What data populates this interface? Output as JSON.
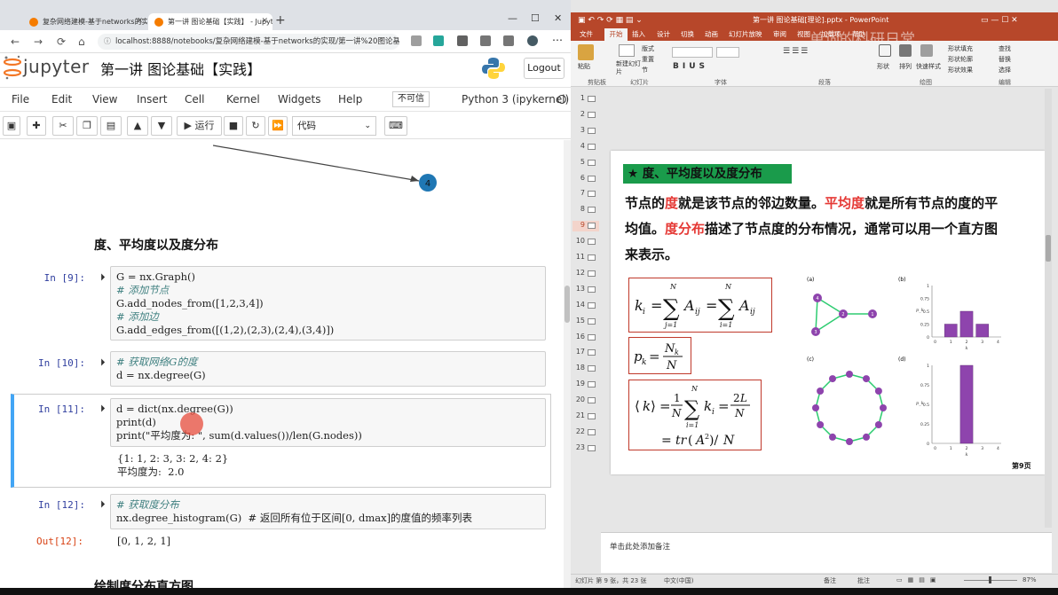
{
  "browser": {
    "tabs": [
      {
        "title": "复杂网络建模-基于networks的实现",
        "active": false
      },
      {
        "title": "第一讲 图论基础【实践】 - Jupyter Not",
        "active": true
      }
    ],
    "url": "localhost:8888/notebooks/复杂网络建模-基于networks的实现/第一讲%20图论基础...",
    "new_tab": "+",
    "window_controls": [
      "—",
      "☐",
      "✕"
    ]
  },
  "jupyter": {
    "logo_text": "jupyter",
    "notebook_title": "第一讲 图论基础【实践】",
    "logout_label": "Logout",
    "menu": [
      "File",
      "Edit",
      "View",
      "Insert",
      "Cell",
      "Kernel",
      "Widgets",
      "Help"
    ],
    "trusted_label": "不可信",
    "kernel_label": "Python 3 (ipykernel)",
    "toolbar": {
      "run_label": "运行",
      "cell_type": "代码"
    }
  },
  "notebook": {
    "graph_node_label": "4",
    "heading1": "度、平均度以及度分布",
    "heading2": "绘制度分布直方图",
    "cells": [
      {
        "prompt": "In  [9]:",
        "lines": [
          "G = nx.Graph()",
          "# 添加节点",
          "G.add_nodes_from([1,2,3,4])",
          "# 添加边",
          "G.add_edges_from([(1,2),(2,3),(2,4),(3,4)])"
        ]
      },
      {
        "prompt": "In  [10]:",
        "lines": [
          "# 获取网络G的度",
          "d = nx.degree(G)"
        ]
      },
      {
        "prompt": "In  [11]:",
        "lines": [
          "d = dict(nx.degree(G))",
          "print(d)",
          "print(\"平均度为: \", sum(d.values())/len(G.nodes))"
        ],
        "output": [
          "{1: 1, 2: 3, 3: 2, 4: 2}",
          "平均度为:  2.0"
        ]
      },
      {
        "prompt": "In  [12]:",
        "lines": [
          "# 获取度分布",
          "nx.degree_histogram(G)  # 返回所有位于区间[0, dmax]的度值的频率列表"
        ],
        "out_prompt": "Out[12]:",
        "output": [
          "[0, 1, 2, 1]"
        ]
      }
    ]
  },
  "ppt": {
    "window_title": "第一讲 图论基础[理论].pptx - PowerPoint",
    "ribbon_tabs": [
      "文件",
      "开始",
      "插入",
      "设计",
      "切换",
      "动画",
      "幻灯片放映",
      "审阅",
      "视图",
      "加载项",
      "帮助"
    ],
    "ribbon_groups": [
      "剪贴板",
      "幻灯片",
      "字体",
      "段落",
      "绘图",
      "编辑"
    ],
    "ribbon_buttons": [
      "粘贴",
      "新建幻灯片",
      "版式",
      "重置",
      "节",
      "形状",
      "排列",
      "快速样式",
      "形状填充",
      "形状轮廓",
      "形状效果",
      "查找",
      "替换",
      "选择"
    ],
    "watermark": "单词的科研日常",
    "slide_numbers": [
      "1",
      "2",
      "3",
      "4",
      "5",
      "6",
      "7",
      "8",
      "9",
      "10",
      "11",
      "12",
      "13",
      "14",
      "15",
      "16",
      "17",
      "18",
      "19",
      "20",
      "21",
      "22",
      "23"
    ],
    "current_slide": "9",
    "slide": {
      "title": "★ 度、平均度以及度分布",
      "p1_a": "节点的",
      "p1_b": "度",
      "p1_c": "就是该节点的邻边数量。",
      "p1_d": "平均度",
      "p1_e": "就是所有节点的度的平",
      "p2_a": "均值。",
      "p2_b": "度分布",
      "p2_c": "描述了节点度的分布情况，通常可以用一个直方图",
      "p3": "来表示。",
      "panel_labels": [
        "(a)",
        "(b)",
        "(c)",
        "(d)"
      ],
      "graph_a_labels": [
        "4",
        "2",
        "1",
        "3"
      ],
      "hist_b_ticks_y": [
        "1",
        "0.75",
        "0.5",
        "0.25",
        "0"
      ],
      "hist_b_ticks_x": [
        "0",
        "1",
        "2",
        "3",
        "4"
      ],
      "hist_d_ticks_y": [
        "1",
        "0.75",
        "0.5",
        "0.25",
        "0"
      ],
      "hist_d_ticks_x": [
        "0",
        "1",
        "2",
        "3",
        "4"
      ],
      "axis_k": "k",
      "axis_p": "p_k",
      "page_label": "第9页"
    },
    "notes_placeholder": "单击此处添加备注",
    "status": {
      "slide_info": "幻灯片 第 9 张，共 23 张",
      "lang": "中文(中国)",
      "notes": "备注",
      "comments": "批注",
      "zoom": "87%"
    }
  },
  "chart_data": [
    {
      "type": "bar",
      "title": "(b)",
      "categories": [
        "1",
        "2",
        "3"
      ],
      "values": [
        0.25,
        0.5,
        0.25
      ],
      "xlabel": "k",
      "ylim": [
        0,
        1
      ]
    },
    {
      "type": "bar",
      "title": "(d)",
      "categories": [
        "2"
      ],
      "values": [
        1.0
      ],
      "xlabel": "k",
      "ylim": [
        0,
        1
      ]
    }
  ],
  "colors": {
    "ppt_accent": "#b7472a",
    "slide_title_bg": "#1a9b4b",
    "node_purple": "#8e44ad",
    "edge_green": "#2ecc71",
    "node_blue": "#1f77b4",
    "highlight_red": "#e53935"
  }
}
